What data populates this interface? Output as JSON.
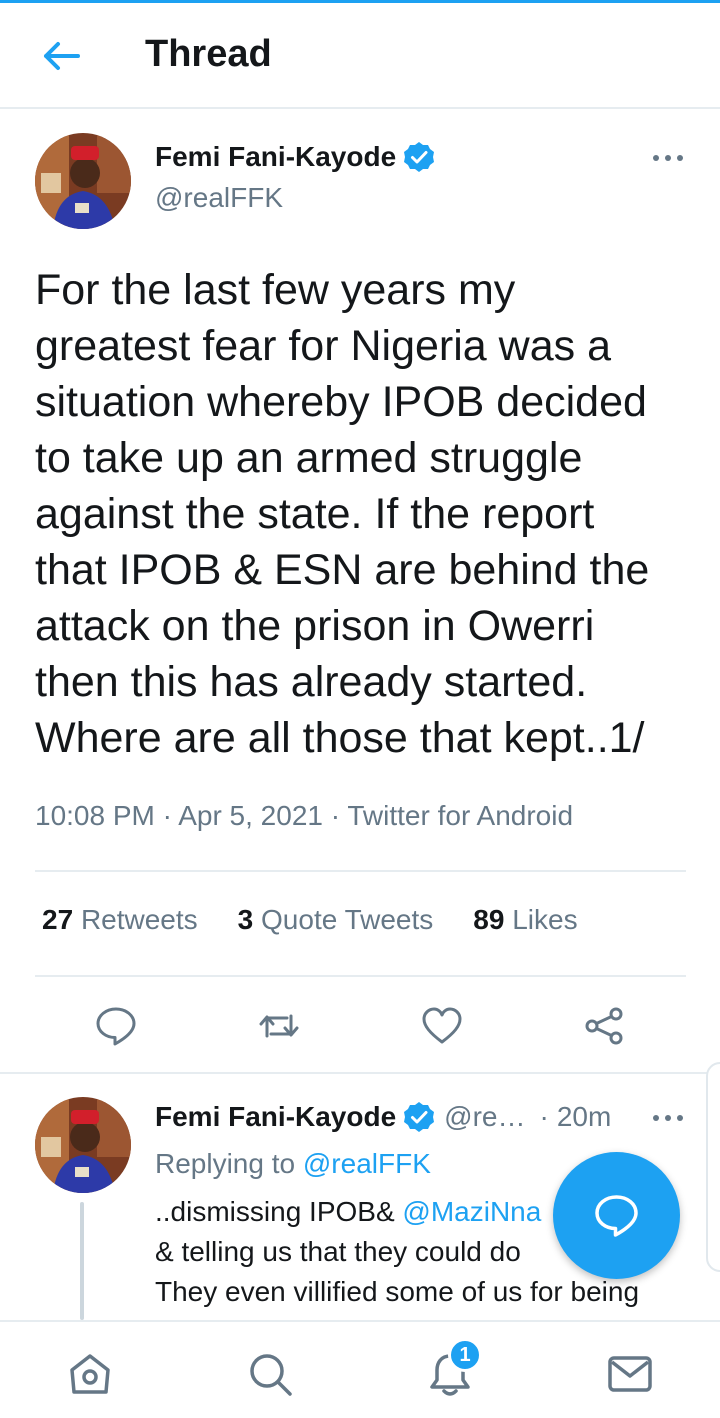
{
  "header": {
    "title": "Thread"
  },
  "main_tweet": {
    "author_name": "Femi Fani-Kayode",
    "handle": "@realFFK",
    "text_lines": [
      "For the last few years my",
      "greatest fear for Nigeria was a",
      "situation whereby IPOB decided",
      "to take up an armed struggle",
      "against the state. If the report",
      "that IPOB & ESN are behind the",
      "attack on the prison in Owerri",
      "then this has already started.",
      "Where are all those that kept..1/"
    ],
    "time": "10:08 PM",
    "separator": "·",
    "date": "Apr 5, 2021",
    "source": "Twitter for Android",
    "stats": {
      "retweets_count": "27",
      "retweets_label": "Retweets",
      "quotes_count": "3",
      "quotes_label": "Quote Tweets",
      "likes_count": "89",
      "likes_label": "Likes"
    }
  },
  "reply_tweet": {
    "author_name": "Femi Fani-Kayode",
    "handle_truncated": "@re…",
    "separator": "·",
    "age": "20m",
    "replying_prefix": "Replying to",
    "replying_handle": "@realFFK",
    "line1_text": "..dismissing IPOB&",
    "line1_mention": "@MaziNna",
    "line2_text": " & telling us that they could do",
    "line3_text": "They even villified some of us for being"
  },
  "notifications": {
    "badge_count": "1"
  },
  "colors": {
    "accent": "#1da1f2",
    "text_primary": "#14171a",
    "text_secondary": "#657786",
    "divider": "#e6ecf0"
  },
  "icons": {
    "back": "arrow-left-icon",
    "verified": "verified-badge-icon",
    "more": "more-horizontal-icon",
    "reply": "reply-bubble-icon",
    "retweet": "retweet-icon",
    "like": "heart-icon",
    "share": "share-icon",
    "compose": "compose-reply-icon",
    "home": "home-icon",
    "search": "search-icon",
    "notifications": "bell-icon",
    "messages": "envelope-icon"
  }
}
